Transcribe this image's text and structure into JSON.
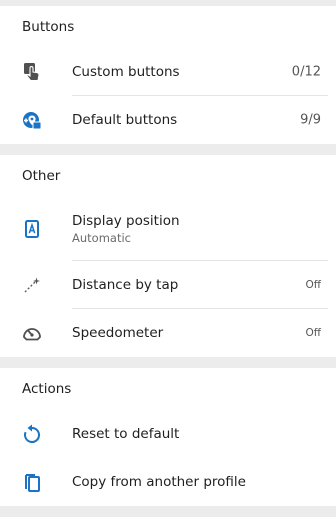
{
  "colors": {
    "accent": "#1a73c4",
    "icon_gray": "#505050",
    "background": "#ececec",
    "card": "#ffffff"
  },
  "sections": {
    "buttons": {
      "header": "Buttons",
      "items": [
        {
          "title": "Custom buttons",
          "value": "0/12",
          "icon": "touch-hand-icon"
        },
        {
          "title": "Default buttons",
          "value": "9/9",
          "icon": "map-marker-plus-icon"
        }
      ]
    },
    "other": {
      "header": "Other",
      "items": [
        {
          "title": "Display position",
          "subtitle": "Automatic",
          "icon": "display-position-icon"
        },
        {
          "title": "Distance by tap",
          "value": "Off",
          "icon": "distance-tap-icon"
        },
        {
          "title": "Speedometer",
          "value": "Off",
          "icon": "speedometer-icon"
        }
      ]
    },
    "actions": {
      "header": "Actions",
      "items": [
        {
          "title": "Reset to default",
          "icon": "reset-icon"
        },
        {
          "title": "Copy from another profile",
          "icon": "copy-icon"
        }
      ]
    }
  }
}
